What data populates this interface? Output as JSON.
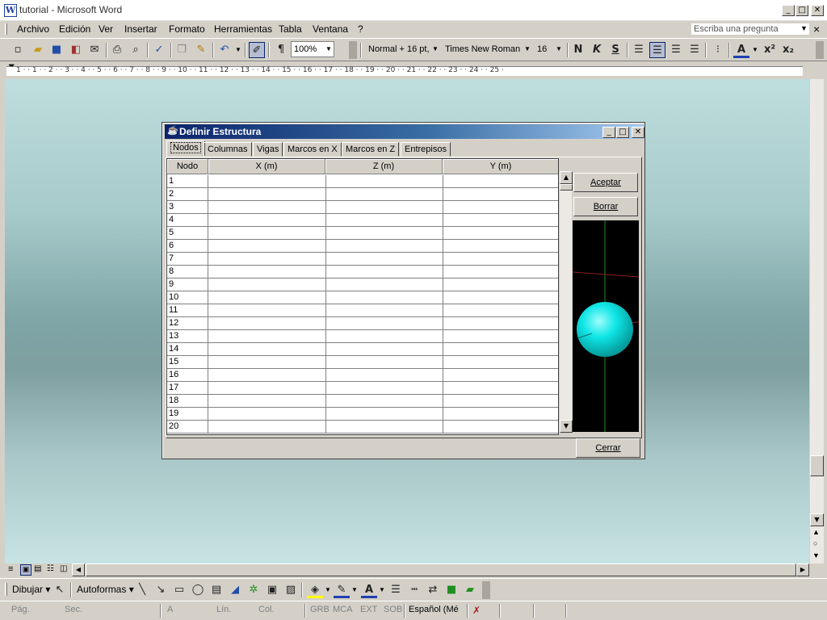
{
  "window": {
    "title": "tutorial - Microsoft Word",
    "minimize": "_",
    "maximize": "□",
    "close": "✕"
  },
  "menu": {
    "items": [
      "Archivo",
      "Edición",
      "Ver",
      "Insertar",
      "Formato",
      "Herramientas",
      "Tabla",
      "Ventana",
      "?"
    ],
    "ask_placeholder": "Escriba una pregunta",
    "close_doc": "×"
  },
  "toolbar": {
    "zoom": "100%",
    "style": "Normal + 16 pt,",
    "font": "Times New Roman",
    "font_size": "16",
    "bold": "N",
    "italic": "K",
    "strike": "S",
    "pilcrow": "¶"
  },
  "ruler": {
    "ticks": "1 · · 1 · · 2 · · 3 · · 4 · · 5 · · 6 · · 7 · · 8 · · 9 · · 10 · · 11 · · 12 · · 13 · · 14 · · 15 · · 16 · · 17 · · 18 · · 19 · · 20 · · 21 · · 22 · · 23 · · 24 · · 25 ·"
  },
  "dialog": {
    "title": "Definir Estructura",
    "tabs": [
      "Nodos",
      "Columnas",
      "Vigas",
      "Marcos en X",
      "Marcos en Z",
      "Entrepisos"
    ],
    "columns": [
      "Nodo",
      "X (m)",
      "Z (m)",
      "Y (m)"
    ],
    "rows": [
      "1",
      "2",
      "3",
      "4",
      "5",
      "6",
      "7",
      "8",
      "9",
      "10",
      "11",
      "12",
      "13",
      "14",
      "15",
      "16",
      "17",
      "18",
      "19",
      "20"
    ],
    "accept": "Aceptar",
    "clear": "Borrar",
    "close": "Cerrar"
  },
  "drawing": {
    "draw": "Dibujar",
    "autoshapes": "Autoformas"
  },
  "status": {
    "page": "Pág.",
    "section": "Sec.",
    "at": "A",
    "line": "Lín.",
    "col": "Col.",
    "grb": "GRB",
    "mca": "MCA",
    "ext": "EXT",
    "sob": "SOB",
    "language": "Español (Mé"
  },
  "colors": {
    "title_bar_start": "#0a246a",
    "title_bar_end": "#a6caf0",
    "sphere": "#10e6e6",
    "preview_bg": "#000000"
  }
}
